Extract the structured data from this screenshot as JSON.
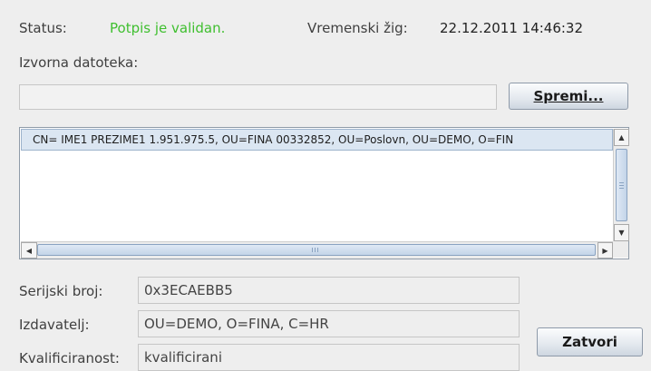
{
  "status": {
    "label": "Status:",
    "value": "Potpis je validan.",
    "value_color": "#3fbf2f"
  },
  "timestamp": {
    "label": "Vremenski žig:",
    "value": "22.12.2011 14:46:32"
  },
  "source_file": {
    "label": "Izvorna datoteka:",
    "value": ""
  },
  "save_button": {
    "label": "Spremi..."
  },
  "certificate_list": {
    "rows": [
      {
        "text": "CN= IME1 PREZIME1   1.951.975.5, OU=FINA 00332852, OU=Poslovn, OU=DEMO, O=FIN"
      }
    ]
  },
  "details": {
    "serial": {
      "label": "Serijski broj:",
      "value": "0x3ECAEBB5"
    },
    "issuer": {
      "label": "Izdavatelj:",
      "value": "OU=DEMO, O=FINA, C=HR"
    },
    "qualification": {
      "label": "Kvalificiranost:",
      "value": "kvalificirani"
    }
  },
  "close_button": {
    "label": "Zatvori"
  },
  "icons": {
    "scroll_up": "arrow-up-icon",
    "scroll_down": "arrow-down-icon",
    "scroll_left": "arrow-left-icon",
    "scroll_right": "arrow-right-icon"
  }
}
